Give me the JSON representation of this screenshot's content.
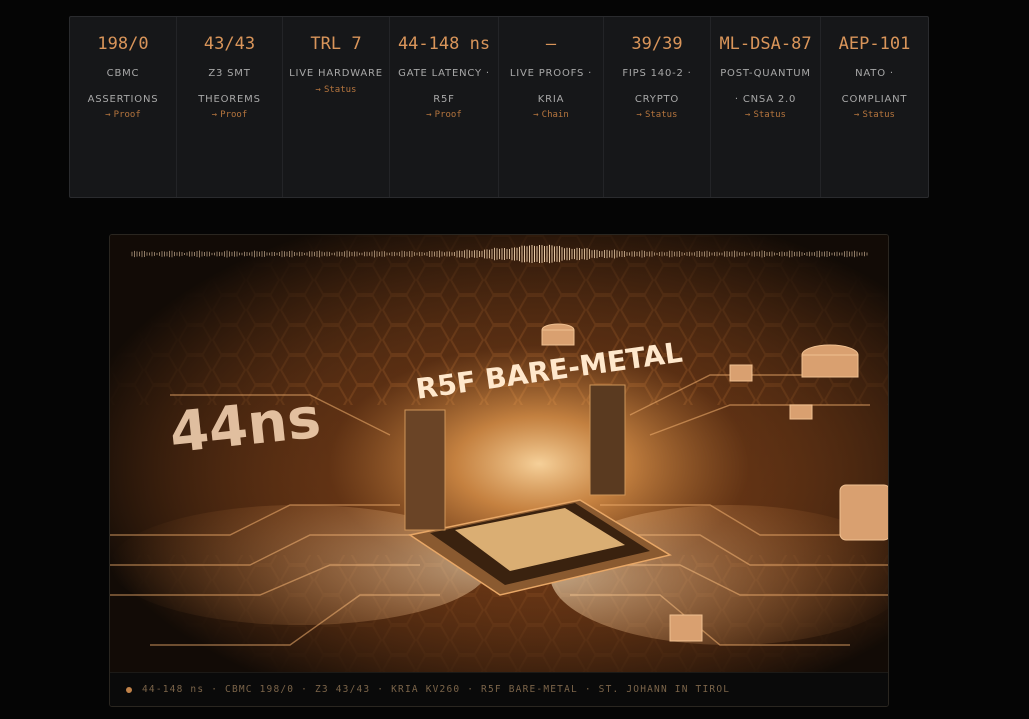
{
  "stats": [
    {
      "value": "198/0",
      "label": "CBMC ASSERTIONS",
      "link": "Proof"
    },
    {
      "value": "43/43",
      "label": "Z3 SMT THEOREMS",
      "link": "Proof"
    },
    {
      "value": "TRL 7",
      "label": "LIVE HARDWARE",
      "link": "Status"
    },
    {
      "value": "44-148 ns",
      "label": "GATE LATENCY · R5F",
      "link": "Proof"
    },
    {
      "value": "—",
      "label": "LIVE PROOFS · KRIA",
      "link": "Chain"
    },
    {
      "value": "39/39",
      "label": "FIPS 140-2 · CRYPTO",
      "link": "Status"
    },
    {
      "value": "ML-DSA-87",
      "label": "POST-QUANTUM · CNSA 2.0",
      "link": "Status"
    },
    {
      "value": "AEP-101",
      "label": "NATO · COMPLIANT",
      "link": "Status"
    }
  ],
  "link_arrow": "→",
  "hero": {
    "chip_text": "R5F BARE-METAL",
    "latency_text": "44ns",
    "caption": "44-148 ns · CBMC 198/0 · Z3 43/43 · KRIA KV260 · R5F BARE-METAL · ST. JOHANN IN TIROL"
  },
  "colors": {
    "accent": "#d9955a",
    "link": "#b5753e",
    "panel": "#161719",
    "background": "#050505"
  }
}
